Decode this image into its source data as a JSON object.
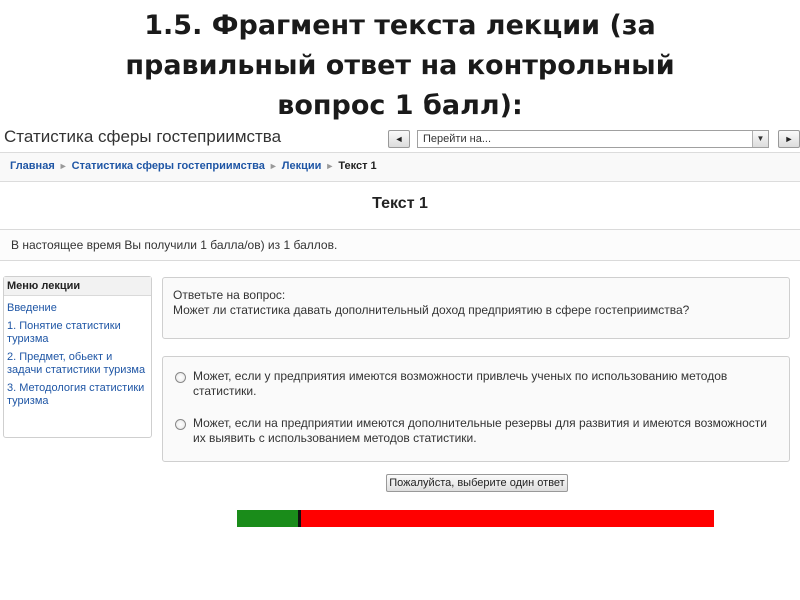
{
  "slide": {
    "title_line1": "1.5. Фрагмент текста лекции (за",
    "title_line2": "правильный ответ на контрольный",
    "title_line3": "вопрос 1 балл):"
  },
  "header": {
    "site_title": "Статистика сферы гостеприимства",
    "prev_icon": "◄",
    "next_icon": "►",
    "jump_placeholder": "Перейти на...",
    "dropdown_icon": "▼"
  },
  "breadcrumb": {
    "items": [
      "Главная",
      "Статистика сферы гостеприимства",
      "Лекции",
      "Текст 1"
    ],
    "separator": "►"
  },
  "page": {
    "heading": "Текст 1",
    "score_text": "В настоящее время Вы получили 1 балла/ов) из 1 баллов."
  },
  "lesson_menu": {
    "title": "Меню лекции",
    "items": [
      "Введение",
      "1. Понятие статистики туризма",
      "2. Предмет, обьект и задачи статистики туризма",
      "3. Методология статистики туризма"
    ]
  },
  "question": {
    "prompt": "Ответьте на вопрос:",
    "text": "Может ли статистика давать дополнительный доход предприятию в сфере гостеприимства?"
  },
  "answers": [
    "Может, если у предприятия имеются возможности привлечь ученых по использованию методов статистики.",
    "Может, если на предприятии имеются дополнительные резервы для развития и имеются возможности их выявить с использованием методов статистики."
  ],
  "submit_label": "Пожалуйста, выберите один ответ",
  "progress": {
    "fraction": 0.135,
    "done_color": "#1a8c1a",
    "remaining_color": "#ff0000"
  }
}
